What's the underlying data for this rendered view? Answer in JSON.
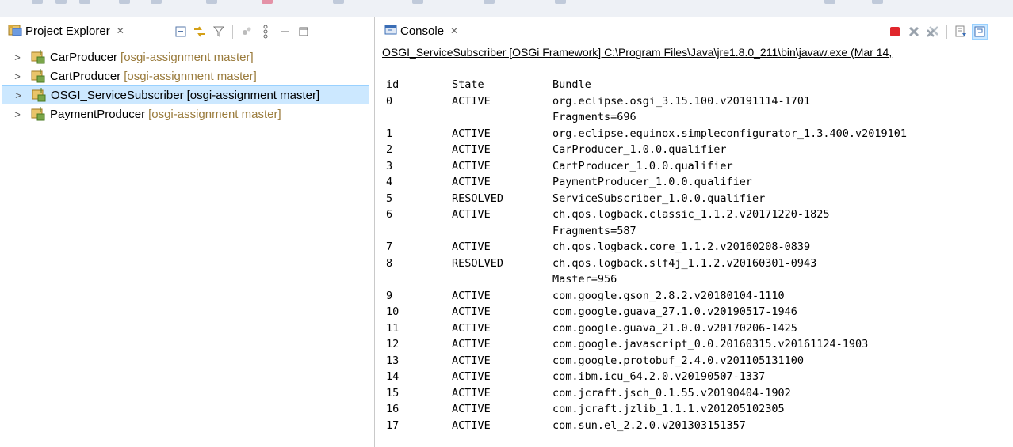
{
  "explorer": {
    "title": "Project Explorer",
    "projects": [
      {
        "name": "CarProducer",
        "decoration": "[osgi-assignment master]",
        "selected": false
      },
      {
        "name": "CartProducer",
        "decoration": "[osgi-assignment master]",
        "selected": false
      },
      {
        "name": "OSGI_ServiceSubscriber",
        "decoration": "[osgi-assignment master]",
        "selected": true
      },
      {
        "name": "PaymentProducer",
        "decoration": "[osgi-assignment master]",
        "selected": false
      }
    ]
  },
  "console": {
    "title": "Console",
    "description": "OSGI_ServiceSubscriber [OSGi Framework] C:\\Program Files\\Java\\jre1.8.0_211\\bin\\javaw.exe (Mar 14,",
    "header": {
      "id": "id",
      "state": "State",
      "bundle": "Bundle"
    },
    "rows": [
      {
        "id": "0",
        "state": "ACTIVE",
        "bundle": "org.eclipse.osgi_3.15.100.v20191114-1701"
      },
      {
        "id": "",
        "state": "",
        "bundle": "Fragments=696"
      },
      {
        "id": "1",
        "state": "ACTIVE",
        "bundle": "org.eclipse.equinox.simpleconfigurator_1.3.400.v2019101"
      },
      {
        "id": "2",
        "state": "ACTIVE",
        "bundle": "CarProducer_1.0.0.qualifier"
      },
      {
        "id": "3",
        "state": "ACTIVE",
        "bundle": "CartProducer_1.0.0.qualifier"
      },
      {
        "id": "4",
        "state": "ACTIVE",
        "bundle": "PaymentProducer_1.0.0.qualifier"
      },
      {
        "id": "5",
        "state": "RESOLVED",
        "bundle": "ServiceSubscriber_1.0.0.qualifier"
      },
      {
        "id": "6",
        "state": "ACTIVE",
        "bundle": "ch.qos.logback.classic_1.1.2.v20171220-1825"
      },
      {
        "id": "",
        "state": "",
        "bundle": "Fragments=587"
      },
      {
        "id": "7",
        "state": "ACTIVE",
        "bundle": "ch.qos.logback.core_1.1.2.v20160208-0839"
      },
      {
        "id": "8",
        "state": "RESOLVED",
        "bundle": "ch.qos.logback.slf4j_1.1.2.v20160301-0943"
      },
      {
        "id": "",
        "state": "",
        "bundle": "Master=956"
      },
      {
        "id": "9",
        "state": "ACTIVE",
        "bundle": "com.google.gson_2.8.2.v20180104-1110"
      },
      {
        "id": "10",
        "state": "ACTIVE",
        "bundle": "com.google.guava_27.1.0.v20190517-1946"
      },
      {
        "id": "11",
        "state": "ACTIVE",
        "bundle": "com.google.guava_21.0.0.v20170206-1425"
      },
      {
        "id": "12",
        "state": "ACTIVE",
        "bundle": "com.google.javascript_0.0.20160315.v20161124-1903"
      },
      {
        "id": "13",
        "state": "ACTIVE",
        "bundle": "com.google.protobuf_2.4.0.v201105131100"
      },
      {
        "id": "14",
        "state": "ACTIVE",
        "bundle": "com.ibm.icu_64.2.0.v20190507-1337"
      },
      {
        "id": "15",
        "state": "ACTIVE",
        "bundle": "com.jcraft.jsch_0.1.55.v20190404-1902"
      },
      {
        "id": "16",
        "state": "ACTIVE",
        "bundle": "com.jcraft.jzlib_1.1.1.v201205102305"
      },
      {
        "id": "17",
        "state": "ACTIVE",
        "bundle": "com.sun.el_2.2.0.v201303151357"
      }
    ]
  },
  "icons": {
    "view_tab": "project-explorer-icon",
    "console_tab": "console-icon",
    "toolbar": [
      "collapse-all-icon",
      "link-with-editor-icon",
      "filter-icon",
      "focus-icon",
      "view-menu-icon",
      "minimize-icon",
      "maximize-icon"
    ],
    "console_toolbar": [
      "terminate-icon",
      "remove-launch-icon",
      "remove-all-terminated-icon",
      "scroll-lock-icon",
      "word-wrap-icon"
    ]
  },
  "colors": {
    "selection_bg": "#cce8ff",
    "decoration_text": "#9a7b3c",
    "terminate_red": "#e0262c"
  }
}
